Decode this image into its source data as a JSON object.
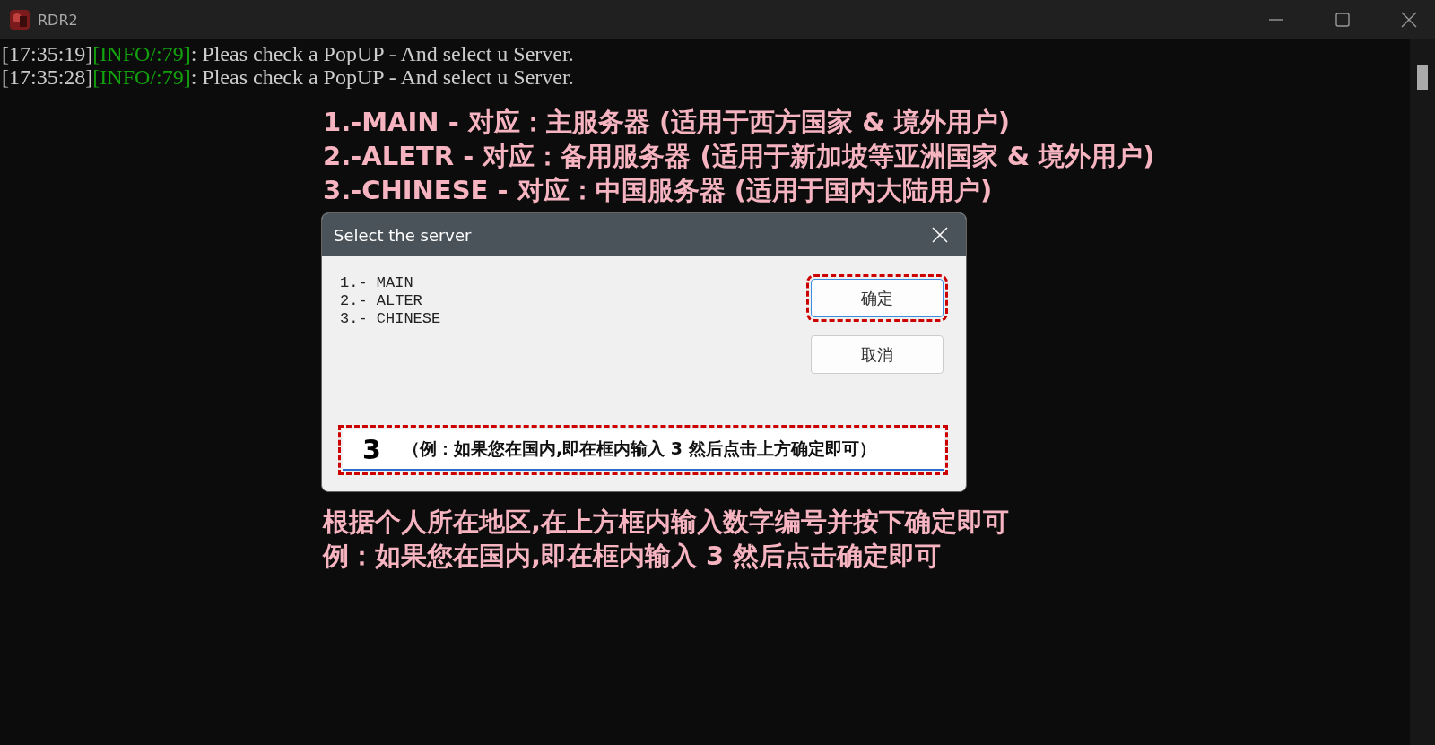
{
  "window": {
    "title": "RDR2"
  },
  "console_lines": [
    {
      "time": "[17:35:19]",
      "tag": "[INFO/:79]",
      "message": ": Pleas check a PopUP - And select u Server."
    },
    {
      "time": "[17:35:28]",
      "tag": "[INFO/:79]",
      "message": ": Pleas check a PopUP - And select u Server."
    }
  ],
  "annotations_top": [
    "1.-MAIN - 对应：主服务器 (适用于西方国家 & 境外用户)",
    "2.-ALETR - 对应：备用服务器 (适用于新加坡等亚洲国家 & 境外用户)",
    "3.-CHINESE - 对应：中国服务器 (适用于国内大陆用户)"
  ],
  "dialog": {
    "title": "Select the server",
    "options": [
      "1.- MAIN",
      "2.- ALTER",
      "3.- CHINESE"
    ],
    "buttons": [
      {
        "label": "确定",
        "highlighted": true
      },
      {
        "label": "取消",
        "highlighted": false
      }
    ],
    "input": {
      "value": "3",
      "annotation": "（例：如果您在国内,即在框内输入 3 然后点击上方确定即可）"
    }
  },
  "annotations_bottom": [
    "根据个人所在地区,在上方框内输入数字编号并按下确定即可",
    "例：如果您在国内,即在框内输入 3 然后点击确定即可"
  ]
}
